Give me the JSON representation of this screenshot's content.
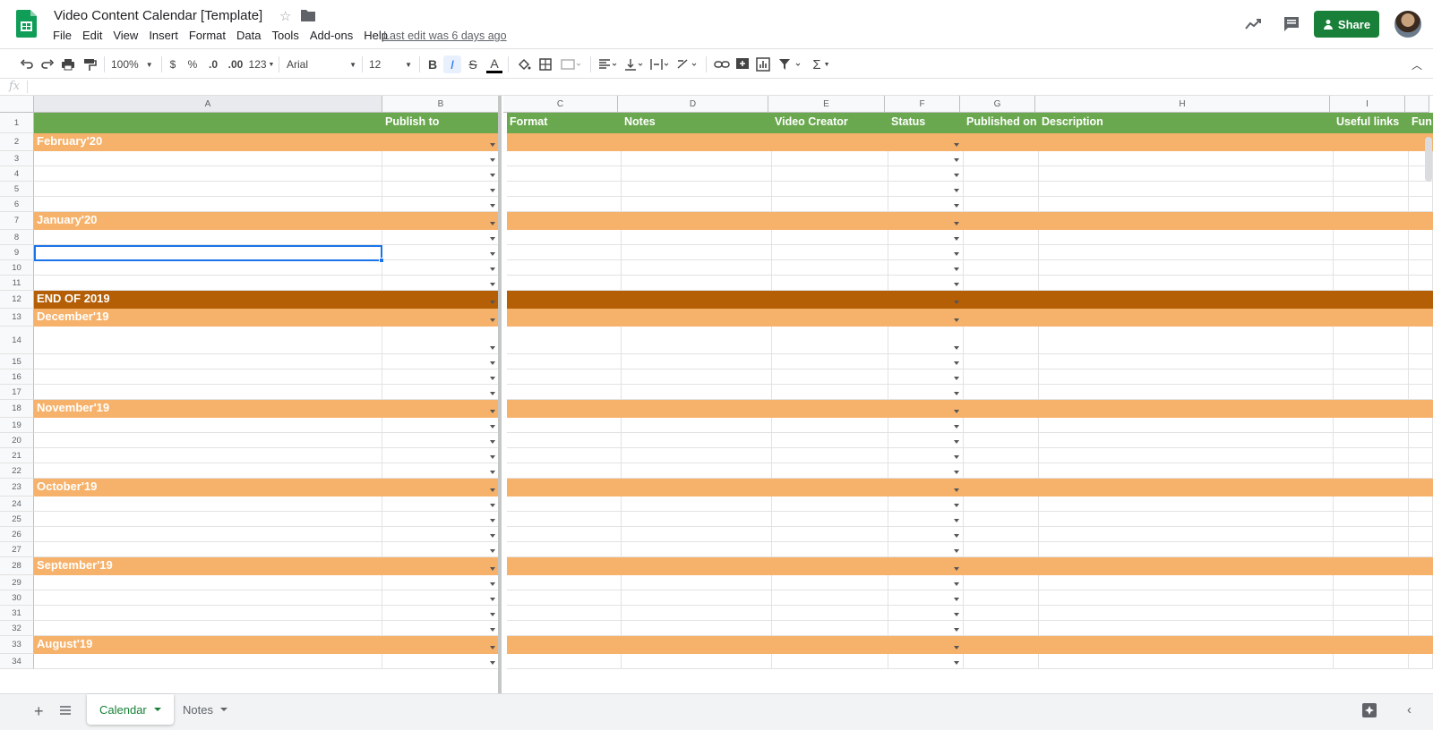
{
  "app": {
    "doc_title": "Video Content Calendar [Template]",
    "last_edit": "Last edit was 6 days ago",
    "share_label": "Share",
    "brand_color": "#188038"
  },
  "menu": [
    "File",
    "Edit",
    "View",
    "Insert",
    "Format",
    "Data",
    "Tools",
    "Add-ons",
    "Help"
  ],
  "toolbar": {
    "zoom": "100%",
    "currency": "$",
    "percent": "%",
    "decrease_decimal": ".0",
    "increase_decimal": ".00",
    "more_formats": "123",
    "font": "Arial",
    "font_size": "12",
    "bold": "B",
    "italic": "I",
    "strike": "S",
    "text_color": "A"
  },
  "formula": {
    "fx": "fx",
    "value": ""
  },
  "columns": [
    "A",
    "B",
    "C",
    "D",
    "E",
    "F",
    "G",
    "H",
    "I"
  ],
  "header_row": {
    "A": "",
    "B": "Publish to",
    "C": "Format",
    "D": "Notes",
    "E": "Video Creator",
    "F": "Status",
    "G": "Published on",
    "H": "Description",
    "I": "Useful links",
    "J": "Fun"
  },
  "rows": [
    {
      "n": "2",
      "label": "February'20",
      "type": "month"
    },
    {
      "n": "3",
      "label": "",
      "type": "blank"
    },
    {
      "n": "4",
      "label": "",
      "type": "blank"
    },
    {
      "n": "5",
      "label": "",
      "type": "blank"
    },
    {
      "n": "6",
      "label": "",
      "type": "blank"
    },
    {
      "n": "7",
      "label": "January'20",
      "type": "month"
    },
    {
      "n": "8",
      "label": "",
      "type": "blank"
    },
    {
      "n": "9",
      "label": "",
      "type": "blank"
    },
    {
      "n": "10",
      "label": "",
      "type": "blank"
    },
    {
      "n": "11",
      "label": "",
      "type": "blank"
    },
    {
      "n": "12",
      "label": "END OF 2019",
      "type": "end"
    },
    {
      "n": "13",
      "label": "December'19",
      "type": "month"
    },
    {
      "n": "14",
      "label": "",
      "type": "blank"
    },
    {
      "n": "15",
      "label": "",
      "type": "blank"
    },
    {
      "n": "16",
      "label": "",
      "type": "blank"
    },
    {
      "n": "17",
      "label": "",
      "type": "blank"
    },
    {
      "n": "18",
      "label": "November'19",
      "type": "month"
    },
    {
      "n": "19",
      "label": "",
      "type": "blank"
    },
    {
      "n": "20",
      "label": "",
      "type": "blank"
    },
    {
      "n": "21",
      "label": "",
      "type": "blank"
    },
    {
      "n": "22",
      "label": "",
      "type": "blank"
    },
    {
      "n": "23",
      "label": "October'19",
      "type": "month"
    },
    {
      "n": "24",
      "label": "",
      "type": "blank"
    },
    {
      "n": "25",
      "label": "",
      "type": "blank"
    },
    {
      "n": "26",
      "label": "",
      "type": "blank"
    },
    {
      "n": "27",
      "label": "",
      "type": "blank"
    },
    {
      "n": "28",
      "label": "September'19",
      "type": "month"
    },
    {
      "n": "29",
      "label": "",
      "type": "blank"
    },
    {
      "n": "30",
      "label": "",
      "type": "blank"
    },
    {
      "n": "31",
      "label": "",
      "type": "blank"
    },
    {
      "n": "32",
      "label": "",
      "type": "blank"
    },
    {
      "n": "33",
      "label": "August'19",
      "type": "month"
    },
    {
      "n": "34",
      "label": "",
      "type": "blank"
    }
  ],
  "selected_cell": "A9",
  "colors": {
    "header_green": "#6aa84f",
    "month_orange": "#f6b26b",
    "end_brown": "#b45f06"
  },
  "sheets": [
    {
      "name": "Calendar",
      "active": true
    },
    {
      "name": "Notes",
      "active": false
    }
  ]
}
